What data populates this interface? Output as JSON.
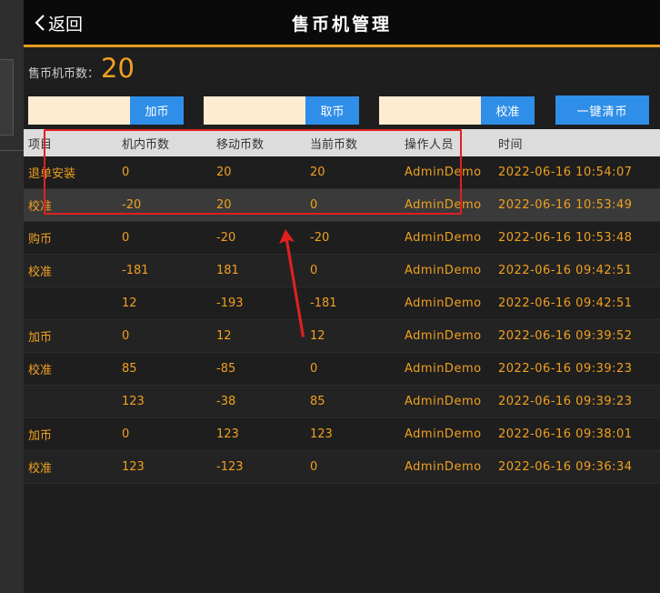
{
  "header": {
    "back_label": "返回",
    "title": "售币机管理"
  },
  "coin_count": {
    "label": "售币机币数：",
    "value": "20"
  },
  "controls": {
    "add": {
      "value": "",
      "button_label": "加币"
    },
    "take": {
      "value": "",
      "button_label": "取币"
    },
    "calibrate": {
      "value": "",
      "button_label": "校准"
    },
    "clear_button_label": "一键清币"
  },
  "table": {
    "columns": [
      "项目",
      "机内币数",
      "移动币数",
      "当前币数",
      "操作人员",
      "时间"
    ],
    "rows": [
      [
        "退单安装",
        "0",
        "20",
        "20",
        "AdminDemo",
        "2022-06-16 10:54:07"
      ],
      [
        "校准",
        "-20",
        "20",
        "0",
        "AdminDemo",
        "2022-06-16 10:53:49"
      ],
      [
        "购币",
        "0",
        "-20",
        "-20",
        "AdminDemo",
        "2022-06-16 10:53:48"
      ],
      [
        "校准",
        "-181",
        "181",
        "0",
        "AdminDemo",
        "2022-06-16 09:42:51"
      ],
      [
        "",
        "12",
        "-193",
        "-181",
        "AdminDemo",
        "2022-06-16 09:42:51"
      ],
      [
        "加币",
        "0",
        "12",
        "12",
        "AdminDemo",
        "2022-06-16 09:39:52"
      ],
      [
        "校准",
        "85",
        "-85",
        "0",
        "AdminDemo",
        "2022-06-16 09:39:23"
      ],
      [
        "",
        "123",
        "-38",
        "85",
        "AdminDemo",
        "2022-06-16 09:39:23"
      ],
      [
        "加币",
        "0",
        "123",
        "123",
        "AdminDemo",
        "2022-06-16 09:38:01"
      ],
      [
        "校准",
        "123",
        "-123",
        "0",
        "AdminDemo",
        "2022-06-16 09:36:34"
      ]
    ]
  },
  "colors": {
    "accent": "#e89a1e",
    "value_text": "#f0a020",
    "button": "#2e8ee8",
    "annotation": "#e02020"
  }
}
